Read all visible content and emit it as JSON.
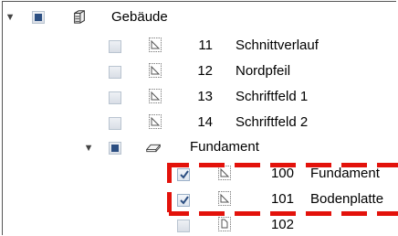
{
  "tree": {
    "root": {
      "label": "Gebäude",
      "state": "partial",
      "icon": "building-icon"
    },
    "children": [
      {
        "number": "11",
        "label": "Schnittverlauf",
        "state": "unchecked"
      },
      {
        "number": "12",
        "label": "Nordpfeil",
        "state": "unchecked"
      },
      {
        "number": "13",
        "label": "Schriftfeld 1",
        "state": "unchecked"
      },
      {
        "number": "14",
        "label": "Schriftfeld 2",
        "state": "unchecked"
      }
    ],
    "group": {
      "label": "Fundament",
      "state": "partial",
      "icon": "slab-icon",
      "children": [
        {
          "number": "100",
          "label": "Fundament",
          "state": "checked"
        },
        {
          "number": "101",
          "label": "Bodenplatte",
          "state": "checked"
        },
        {
          "number": "102",
          "label": "",
          "state": "unchecked"
        }
      ]
    }
  },
  "highlight_color": "#e3120b"
}
